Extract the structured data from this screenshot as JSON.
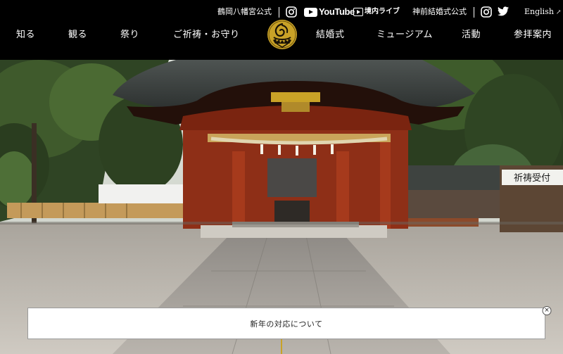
{
  "header": {
    "utility": {
      "site_name": "鶴岡八幡宮公式",
      "youtube": "YouTube",
      "live": "境内ライブ",
      "wedding": "神前結婚式公式",
      "english": "English",
      "external_arrow": "↗"
    },
    "nav": {
      "left": [
        "知る",
        "観る",
        "祭り",
        "ご祈祷・お守り"
      ],
      "right": [
        "結婚式",
        "ミュージアム",
        "活動",
        "参拝案内"
      ]
    }
  },
  "hero": {
    "signboard": "祈祷受付"
  },
  "notice": {
    "text": "新年の対応について",
    "close_symbol": "×"
  },
  "colors": {
    "header_bg": "#000000",
    "crest_gold": "#c9a227",
    "shrine_red": "#a63a1c"
  },
  "icons": [
    "instagram-icon",
    "youtube-icon",
    "live-camera-icon",
    "twitter-icon",
    "crest-icon",
    "close-icon"
  ]
}
